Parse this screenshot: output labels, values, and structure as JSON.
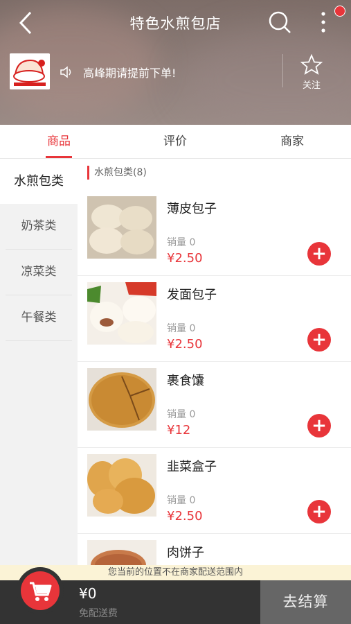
{
  "header": {
    "title": "特色水煎包店",
    "notice": "高峰期请提前下单!",
    "follow_label": "关注"
  },
  "tabs": [
    {
      "label": "商品",
      "active": true
    },
    {
      "label": "评价",
      "active": false
    },
    {
      "label": "商家",
      "active": false
    }
  ],
  "sidebar": {
    "items": [
      {
        "label": "水煎包类",
        "active": true
      },
      {
        "label": "奶茶类",
        "active": false
      },
      {
        "label": "凉菜类",
        "active": false
      },
      {
        "label": "午餐类",
        "active": false
      }
    ]
  },
  "category_title": "水煎包类(8)",
  "products": [
    {
      "name": "薄皮包子",
      "sales": "销量 0",
      "price": "¥2.50"
    },
    {
      "name": "发面包子",
      "sales": "销量 0",
      "price": "¥2.50"
    },
    {
      "name": "裹食馕",
      "sales": "销量 0",
      "price": "¥12"
    },
    {
      "name": "韭菜盒子",
      "sales": "销量 0",
      "price": "¥2.50"
    },
    {
      "name": "肉饼子",
      "sales": "",
      "price": ""
    }
  ],
  "warning": "您当前的位置不在商家配送范围内",
  "cart": {
    "total": "¥0",
    "delivery": "免配送费",
    "checkout_label": "去结算"
  },
  "colors": {
    "accent": "#e8353a",
    "bottom_bar": "#333333",
    "checkout_bg": "#666666"
  }
}
